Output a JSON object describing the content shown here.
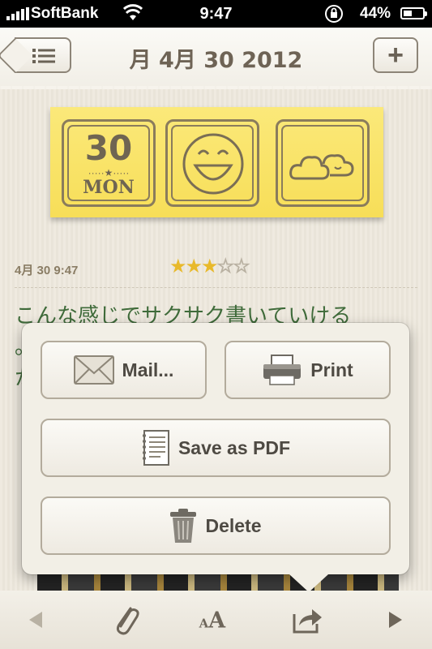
{
  "status_bar": {
    "carrier": "SoftBank",
    "time": "9:47",
    "battery_percent": "44%",
    "battery_level": 0.44,
    "icons": [
      "signal-icon",
      "wifi-icon",
      "rotation-lock-icon",
      "battery-icon"
    ]
  },
  "nav": {
    "title": "月 4月 30 2012",
    "list_button_icon": "list-icon",
    "add_button_icon": "plus-icon",
    "add_label": "+"
  },
  "sticky": {
    "day_number": "30",
    "day_name": "MON",
    "mood_icon": "laughing-face-icon",
    "weather_icon": "cloudy-icon"
  },
  "entry": {
    "datetime": "4月 30 9:47",
    "rating": 3,
    "rating_max": 5,
    "stars_on": "★★★",
    "stars_off": "☆☆",
    "text_line1": "こんな感じでサクサク書いていける",
    "text_line2": "。",
    "text_line3": "か"
  },
  "share_menu": {
    "mail": "Mail...",
    "print": "Print",
    "save_pdf": "Save as PDF",
    "delete": "Delete"
  },
  "toolbar": {
    "font_label": "AA",
    "icons": [
      "prev-icon",
      "paperclip-icon",
      "font-size-icon",
      "share-icon",
      "next-icon"
    ]
  },
  "colors": {
    "note_yellow": "#f7de58",
    "body_text": "#3f6b3a",
    "star_on": "#e8b92b"
  }
}
